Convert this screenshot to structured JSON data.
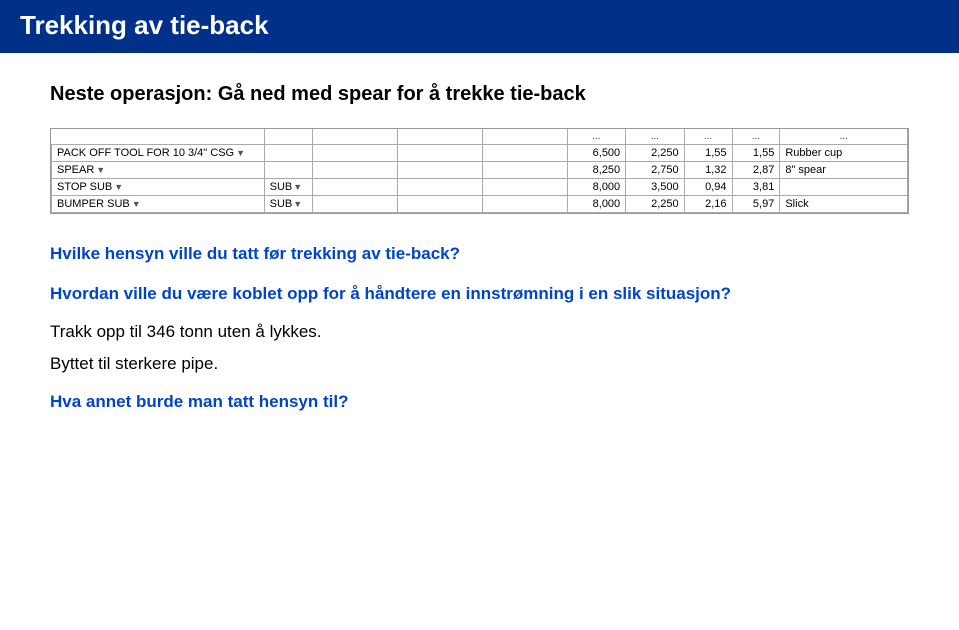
{
  "header": {
    "title": "Trekking av  tie-back"
  },
  "content": {
    "next_operation_label": "Neste operasjon: Gå ned med spear for å trekke tie-back",
    "table": {
      "header_cols": [
        "...",
        "...",
        "...",
        "..."
      ],
      "rows": [
        {
          "name": "PACK OFF TOOL FOR 10 3/4\" CSG",
          "sub": "",
          "empty1": "",
          "empty2": "",
          "empty3": "",
          "num1": "6,500",
          "num2": "2,250",
          "num3": "1,55",
          "num4": "1,55",
          "desc": "Rubber cup"
        },
        {
          "name": "SPEAR",
          "sub": "",
          "empty1": "",
          "empty2": "",
          "empty3": "",
          "num1": "8,250",
          "num2": "2,750",
          "num3": "1,32",
          "num4": "2,87",
          "desc": "8\" spear"
        },
        {
          "name": "STOP SUB",
          "sub": "SUB",
          "empty1": "",
          "empty2": "",
          "empty3": "",
          "num1": "8,000",
          "num2": "3,500",
          "num3": "0,94",
          "num4": "3,81",
          "desc": ""
        },
        {
          "name": "BUMPER SUB",
          "sub": "SUB",
          "empty1": "",
          "empty2": "",
          "empty3": "",
          "num1": "8,000",
          "num2": "2,250",
          "num3": "2,16",
          "num4": "5,97",
          "desc": "Slick"
        }
      ]
    },
    "questions": [
      {
        "id": "q1",
        "text": "Hvilke hensyn ville du tatt før trekking av tie-back?",
        "style": "blue-bold"
      },
      {
        "id": "q2",
        "text": "Hvordan ville du være koblet opp for å håndtere en innstrømning i en slik situasjon?",
        "style": "blue-bold"
      }
    ],
    "statements": [
      {
        "id": "s1",
        "text": "Trakk opp til 346 tonn uten å lykkes."
      },
      {
        "id": "s2",
        "text": "Byttet til sterkere pipe."
      }
    ],
    "final_question": {
      "text": "Hva annet burde man tatt hensyn til?"
    }
  }
}
